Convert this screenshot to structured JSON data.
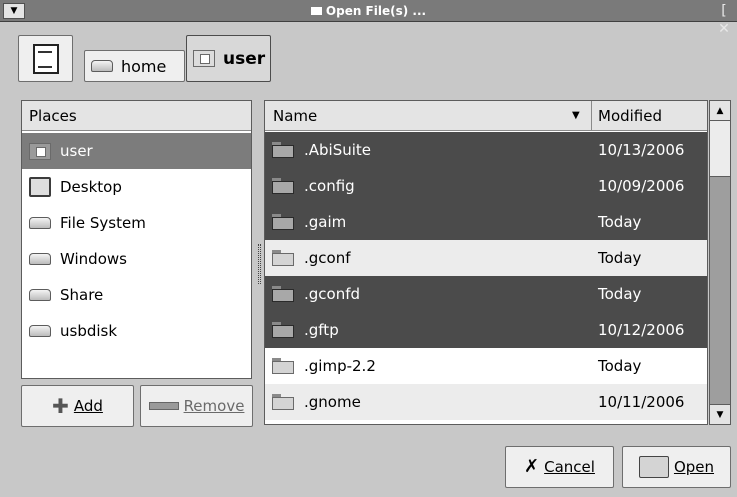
{
  "window": {
    "title": "Open File(s) ...",
    "menu_glyph": "▼",
    "close_glyph": "[ ✕"
  },
  "path_bar": {
    "crumbs": [
      {
        "label": "home",
        "icon": "drive-icon"
      },
      {
        "label": "user",
        "icon": "home-folder-icon",
        "active": true
      }
    ],
    "edit_icon": "document-edit-icon"
  },
  "places": {
    "header": "Places",
    "items": [
      {
        "label": "user",
        "icon": "home-folder-icon",
        "selected": true
      },
      {
        "label": "Desktop",
        "icon": "desktop-icon"
      },
      {
        "label": "File System",
        "icon": "drive-icon"
      },
      {
        "label": "Windows",
        "icon": "drive-icon"
      },
      {
        "label": "Share",
        "icon": "drive-icon"
      },
      {
        "label": "usbdisk",
        "icon": "drive-icon"
      }
    ],
    "add_label": "Add",
    "remove_label": "Remove"
  },
  "files": {
    "columns": {
      "name": "Name",
      "modified": "Modified"
    },
    "rows": [
      {
        "name": ".AbiSuite",
        "modified": "10/13/2006",
        "selected": true
      },
      {
        "name": ".config",
        "modified": "10/09/2006",
        "selected": true
      },
      {
        "name": ".gaim",
        "modified": "Today",
        "selected": true
      },
      {
        "name": ".gconf",
        "modified": "Today",
        "selected": false
      },
      {
        "name": ".gconfd",
        "modified": "Today",
        "selected": true
      },
      {
        "name": ".gftp",
        "modified": "10/12/2006",
        "selected": true
      },
      {
        "name": ".gimp-2.2",
        "modified": "Today",
        "selected": false
      },
      {
        "name": ".gnome",
        "modified": "10/11/2006",
        "selected": false
      }
    ]
  },
  "buttons": {
    "cancel_label": "Cancel",
    "open_label": "Open"
  }
}
